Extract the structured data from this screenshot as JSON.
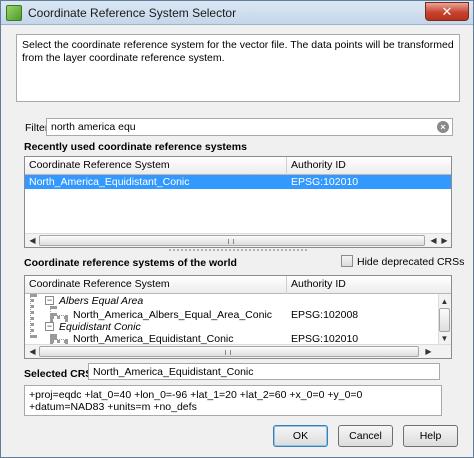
{
  "window": {
    "title": "Coordinate Reference System Selector",
    "close_glyph": "✕",
    "icon": "qgis-app-icon"
  },
  "description": "Select the coordinate reference system for the vector file. The data points will be transformed from the layer coordinate reference system.",
  "filter": {
    "label": "Filter",
    "value": "north america equ",
    "clear_icon": "clear-icon"
  },
  "recent": {
    "title": "Recently used coordinate reference systems",
    "columns": [
      "Coordinate Reference System",
      "Authority ID"
    ],
    "rows": [
      {
        "name": "North_America_Equidistant_Conic",
        "authority": "EPSG:102010",
        "selected": true
      }
    ]
  },
  "world": {
    "title": "Coordinate reference systems of the world",
    "hide_deprecated_label": "Hide deprecated CRSs",
    "hide_deprecated_checked": false,
    "columns": [
      "Coordinate Reference System",
      "Authority ID"
    ],
    "groups": [
      {
        "name": "Albers Equal Area",
        "items": [
          {
            "name": "North_America_Albers_Equal_Area_Conic",
            "authority": "EPSG:102008"
          }
        ]
      },
      {
        "name": "Equidistant Conic",
        "items": [
          {
            "name": "North_America_Equidistant_Conic",
            "authority": "EPSG:102010"
          }
        ]
      }
    ]
  },
  "selected_crs": {
    "label": "Selected CRS:",
    "value": "North_America_Equidistant_Conic"
  },
  "proj_string": "+proj=eqdc +lat_0=40 +lon_0=-96 +lat_1=20 +lat_2=60 +x_0=0 +y_0=0 +datum=NAD83 +units=m +no_defs",
  "buttons": {
    "ok": "OK",
    "cancel": "Cancel",
    "help": "Help"
  },
  "scroll": {
    "left": "◀",
    "right": "▶",
    "up": "▲",
    "down": "▼"
  },
  "tree_toggle": "−"
}
